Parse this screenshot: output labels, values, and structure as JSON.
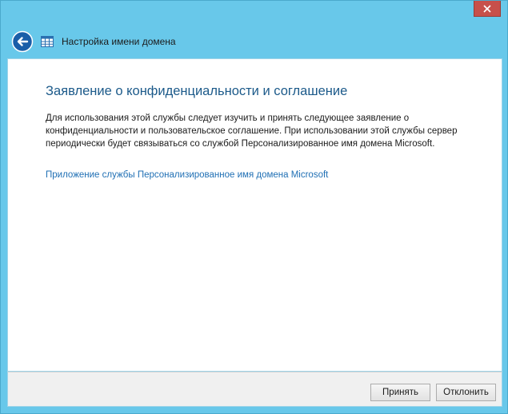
{
  "window": {
    "title": "Настройка имени домена",
    "close_label": "Закрыть"
  },
  "content": {
    "heading": "Заявление о конфиденциальности и соглашение",
    "body": "Для использования этой службы следует изучить и принять следующее заявление о конфиденциальности и пользовательское соглашение. При использовании этой службы сервер периодически будет связываться со службой Персонализированное имя домена Microsoft.",
    "link_text": "Приложение службы Персонализированное имя домена Microsoft"
  },
  "footer": {
    "accept_label": "Принять",
    "cancel_label": "Отклонить"
  },
  "icons": {
    "back": "back-arrow-icon",
    "app": "grid-app-icon",
    "close": "close-icon"
  },
  "colors": {
    "frame": "#68c8ea",
    "heading": "#1c5a8a",
    "link": "#1f6fb4",
    "close": "#c7504a"
  }
}
